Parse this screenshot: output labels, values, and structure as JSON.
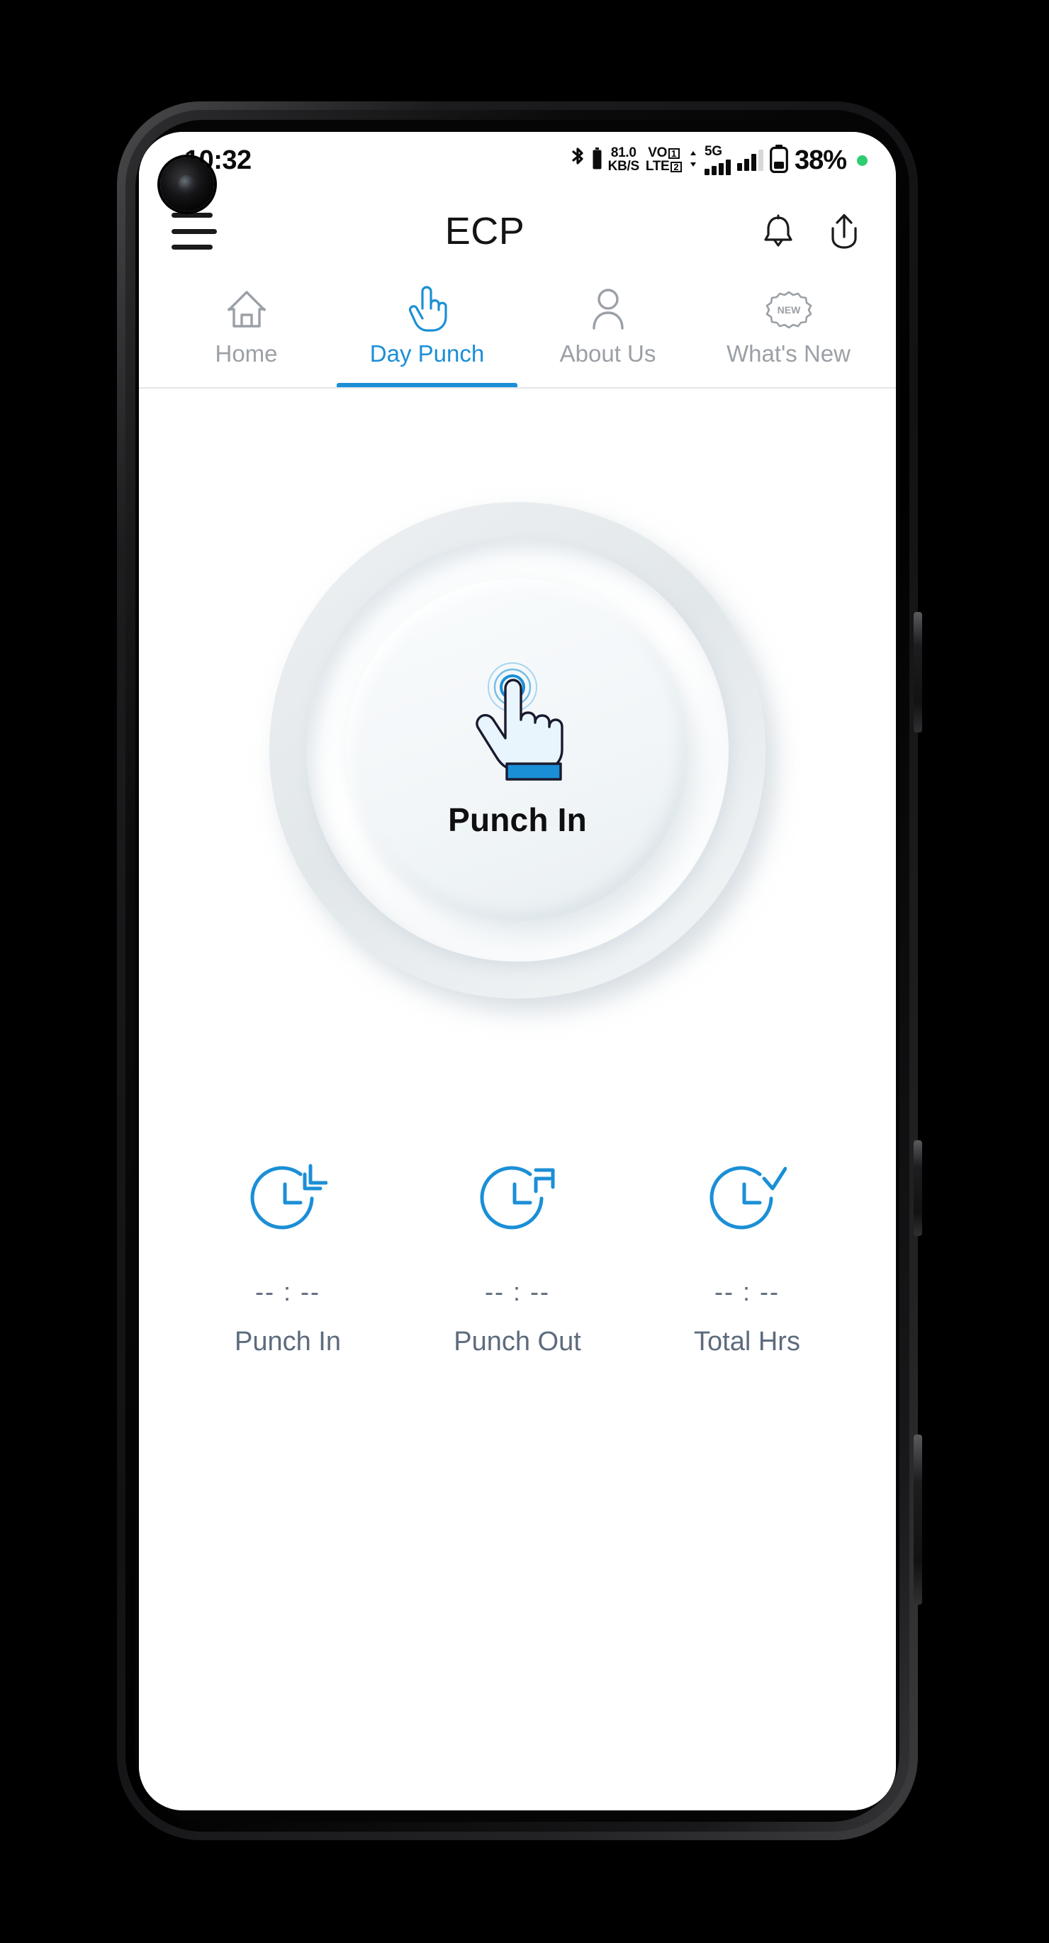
{
  "status_bar": {
    "time": "10:32",
    "bluetooth_icon": "bluetooth-icon",
    "bluetooth_battery_icon": "bluetooth-battery-icon",
    "net_speed_value": "81.0",
    "net_speed_unit": "KB/S",
    "volte_label_top": "VO",
    "volte_label_bottom": "LTE",
    "volte_sim1": "1",
    "volte_sim2": "2",
    "data_arrows_icon": "data-transfer-arrows-icon",
    "network_type": "5G",
    "signal1_icon": "signal-bars-sim1-icon",
    "signal2_icon": "signal-bars-sim2-icon",
    "battery_icon": "battery-icon",
    "battery_percent": "38%",
    "recording_dot_color": "#2ecc71"
  },
  "header": {
    "menu_icon": "hamburger-menu-icon",
    "title": "ECP",
    "bell_icon": "notification-bell-icon",
    "share_icon": "upload-share-icon"
  },
  "tabs": {
    "active_index": 1,
    "items": [
      {
        "label": "Home",
        "icon": "home-icon"
      },
      {
        "label": "Day Punch",
        "icon": "pointing-hand-icon"
      },
      {
        "label": "About Us",
        "icon": "person-icon"
      },
      {
        "label": "What's New",
        "icon": "new-starburst-icon",
        "badge": "NEW"
      }
    ]
  },
  "punch_button": {
    "label": "Punch In",
    "icon": "tap-hand-icon"
  },
  "stats": [
    {
      "icon": "clock-punch-in-icon",
      "value": "-- : --",
      "label": "Punch In"
    },
    {
      "icon": "clock-punch-out-icon",
      "value": "-- : --",
      "label": "Punch Out"
    },
    {
      "icon": "clock-check-icon",
      "value": "-- : --",
      "label": "Total Hrs"
    }
  ],
  "colors": {
    "accent_blue": "#1b8fd6",
    "muted_gray": "#9ba0a6",
    "slate": "#5d6b7d",
    "text_dark": "#141414"
  }
}
